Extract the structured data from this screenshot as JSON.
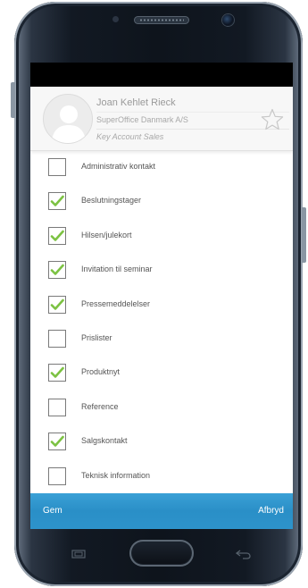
{
  "contact": {
    "name": "Joan Kehlet Rieck",
    "company": "SuperOffice Danmark A/S",
    "title": "Key Account Sales"
  },
  "interests": [
    {
      "label": "Administrativ kontakt",
      "checked": false
    },
    {
      "label": "Beslutningstager",
      "checked": true
    },
    {
      "label": "Hilsen/julekort",
      "checked": true
    },
    {
      "label": "Invitation til seminar",
      "checked": true
    },
    {
      "label": "Pressemeddelelser",
      "checked": true
    },
    {
      "label": "Prislister",
      "checked": false
    },
    {
      "label": "Produktnyt",
      "checked": true
    },
    {
      "label": "Reference",
      "checked": false
    },
    {
      "label": "Salgskontakt",
      "checked": true
    },
    {
      "label": "Teknisk information",
      "checked": false
    }
  ],
  "actions": {
    "save_label": "Gem",
    "cancel_label": "Afbryd"
  },
  "colors": {
    "accent": "#2d93cb",
    "check": "#7cc242"
  },
  "icons": {
    "avatar": "person-silhouette-icon",
    "favorite": "star-outline-icon",
    "check": "checkmark-icon"
  }
}
